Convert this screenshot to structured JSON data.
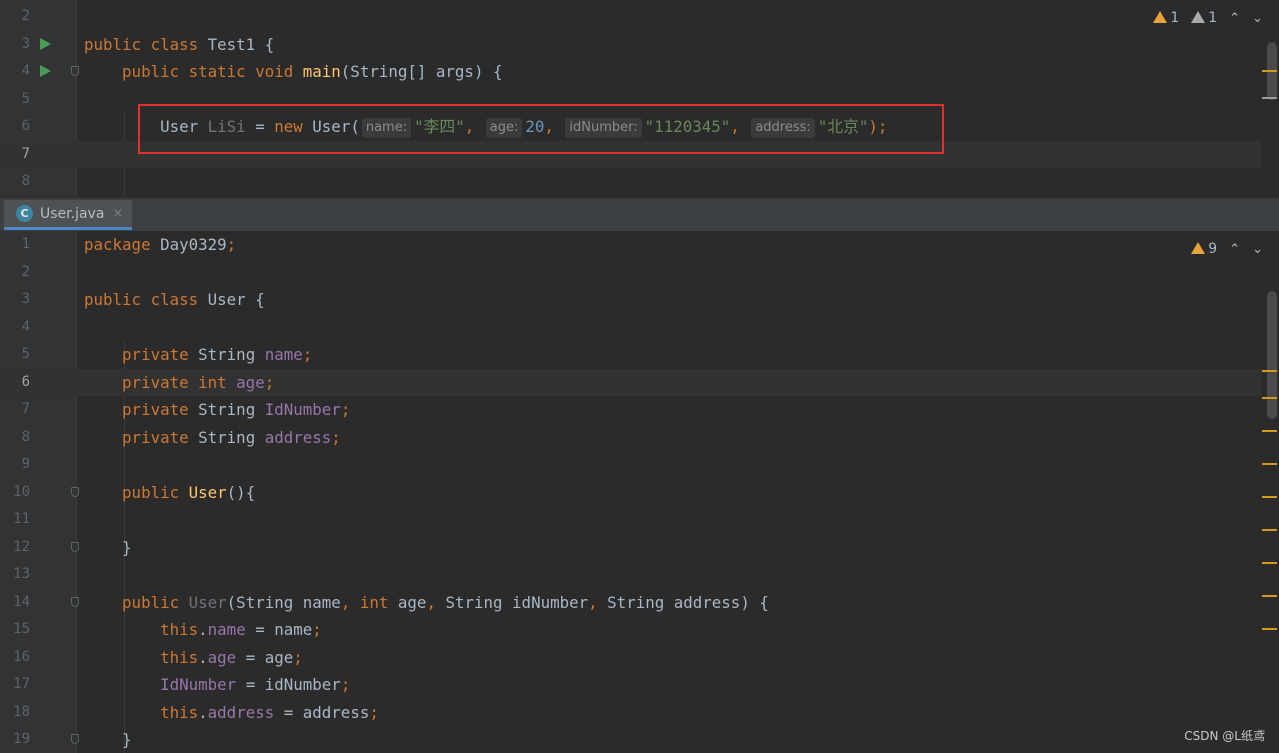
{
  "top_editor": {
    "inspections": {
      "warnings": "1",
      "weak_warnings": "1",
      "prev_icon": "chevron-up-icon",
      "next_icon": "chevron-down-icon"
    },
    "lines": [
      {
        "num": "2",
        "tokens": []
      },
      {
        "num": "3",
        "tokens": [
          {
            "t": "public class ",
            "c": "kw"
          },
          {
            "t": "Test1 {",
            "c": ""
          }
        ]
      },
      {
        "num": "4",
        "tokens": [
          {
            "t": "    public static void ",
            "c": "kw"
          },
          {
            "t": "main",
            "c": "fn"
          },
          {
            "t": "(String[] args) {",
            "c": ""
          }
        ]
      },
      {
        "num": "5",
        "tokens": []
      },
      {
        "num": "6",
        "tokens": [
          {
            "t": "        User ",
            "c": ""
          },
          {
            "t": "LiSi",
            "c": "unused"
          },
          {
            "t": " = ",
            "c": ""
          },
          {
            "t": "new ",
            "c": "kw"
          },
          {
            "t": "User(",
            "c": ""
          },
          {
            "hint": "name:"
          },
          {
            "t": "\"李四\"",
            "c": "str"
          },
          {
            "t": ", ",
            "c": "kw"
          },
          {
            "hint": "age:"
          },
          {
            "t": "20",
            "c": "num"
          },
          {
            "t": ", ",
            "c": "kw"
          },
          {
            "hint": "idNumber:"
          },
          {
            "t": "\"1120345\"",
            "c": "str"
          },
          {
            "t": ", ",
            "c": "kw"
          },
          {
            "hint": "address:"
          },
          {
            "t": "\"北京\"",
            "c": "str"
          },
          {
            "t": ");",
            "c": "kw"
          }
        ]
      },
      {
        "num": "7",
        "tokens": []
      },
      {
        "num": "8",
        "tokens": []
      }
    ]
  },
  "tab": {
    "label": "User.java",
    "icon_letter": "C",
    "close_glyph": "×"
  },
  "bottom_editor": {
    "inspections": {
      "warnings": "9",
      "prev_icon": "chevron-up-icon",
      "next_icon": "chevron-down-icon"
    },
    "lines": [
      {
        "num": "1",
        "tokens": [
          {
            "t": "package ",
            "c": "kw"
          },
          {
            "t": "Day0329",
            "c": ""
          },
          {
            "t": ";",
            "c": "kw"
          }
        ]
      },
      {
        "num": "2",
        "tokens": []
      },
      {
        "num": "3",
        "tokens": [
          {
            "t": "public class ",
            "c": "kw"
          },
          {
            "t": "User {",
            "c": ""
          }
        ]
      },
      {
        "num": "4",
        "tokens": []
      },
      {
        "num": "5",
        "tokens": [
          {
            "t": "    private ",
            "c": "kw"
          },
          {
            "t": "String ",
            "c": ""
          },
          {
            "t": "name",
            "c": "fld"
          },
          {
            "t": ";",
            "c": "kw"
          }
        ]
      },
      {
        "num": "6",
        "tokens": [
          {
            "t": "    private int ",
            "c": "kw"
          },
          {
            "t": "age",
            "c": "fld"
          },
          {
            "t": ";",
            "c": "kw"
          }
        ]
      },
      {
        "num": "7",
        "tokens": [
          {
            "t": "    private ",
            "c": "kw"
          },
          {
            "t": "String ",
            "c": ""
          },
          {
            "t": "IdNumber",
            "c": "fld"
          },
          {
            "t": ";",
            "c": "kw"
          }
        ]
      },
      {
        "num": "8",
        "tokens": [
          {
            "t": "    private ",
            "c": "kw"
          },
          {
            "t": "String ",
            "c": ""
          },
          {
            "t": "address",
            "c": "fld"
          },
          {
            "t": ";",
            "c": "kw"
          }
        ]
      },
      {
        "num": "9",
        "tokens": []
      },
      {
        "num": "10",
        "tokens": [
          {
            "t": "    public ",
            "c": "kw"
          },
          {
            "t": "User",
            "c": "fn"
          },
          {
            "t": "(){",
            "c": ""
          }
        ]
      },
      {
        "num": "11",
        "tokens": []
      },
      {
        "num": "12",
        "tokens": [
          {
            "t": "    }",
            "c": ""
          }
        ]
      },
      {
        "num": "13",
        "tokens": []
      },
      {
        "num": "14",
        "tokens": [
          {
            "t": "    public ",
            "c": "kw"
          },
          {
            "t": "User",
            "c": "unused"
          },
          {
            "t": "(String name",
            "c": ""
          },
          {
            "t": ", int ",
            "c": "kw"
          },
          {
            "t": "age",
            "c": ""
          },
          {
            "t": ", ",
            "c": "kw"
          },
          {
            "t": "String idNumber",
            "c": ""
          },
          {
            "t": ", ",
            "c": "kw"
          },
          {
            "t": "String address) {",
            "c": ""
          }
        ]
      },
      {
        "num": "15",
        "tokens": [
          {
            "t": "        this",
            "c": "kw"
          },
          {
            "t": ".",
            "c": ""
          },
          {
            "t": "name",
            "c": "fld"
          },
          {
            "t": " = name",
            "c": ""
          },
          {
            "t": ";",
            "c": "kw"
          }
        ]
      },
      {
        "num": "16",
        "tokens": [
          {
            "t": "        this",
            "c": "kw"
          },
          {
            "t": ".",
            "c": ""
          },
          {
            "t": "age",
            "c": "fld"
          },
          {
            "t": " = age",
            "c": ""
          },
          {
            "t": ";",
            "c": "kw"
          }
        ]
      },
      {
        "num": "17",
        "tokens": [
          {
            "t": "        ",
            "c": ""
          },
          {
            "t": "IdNumber",
            "c": "fld"
          },
          {
            "t": " = idNumber",
            "c": ""
          },
          {
            "t": ";",
            "c": "kw"
          }
        ]
      },
      {
        "num": "18",
        "tokens": [
          {
            "t": "        this",
            "c": "kw"
          },
          {
            "t": ".",
            "c": ""
          },
          {
            "t": "address",
            "c": "fld"
          },
          {
            "t": " = address",
            "c": ""
          },
          {
            "t": ";",
            "c": "kw"
          }
        ]
      },
      {
        "num": "19",
        "tokens": [
          {
            "t": "    }",
            "c": ""
          }
        ]
      }
    ]
  },
  "watermark": "CSDN @L纸鸢",
  "colors": {
    "keyword": "#cc7832",
    "field": "#9876aa",
    "string": "#6a8759",
    "number": "#6897bb",
    "method": "#ffc66d",
    "highlight_box": "#e0312d"
  }
}
